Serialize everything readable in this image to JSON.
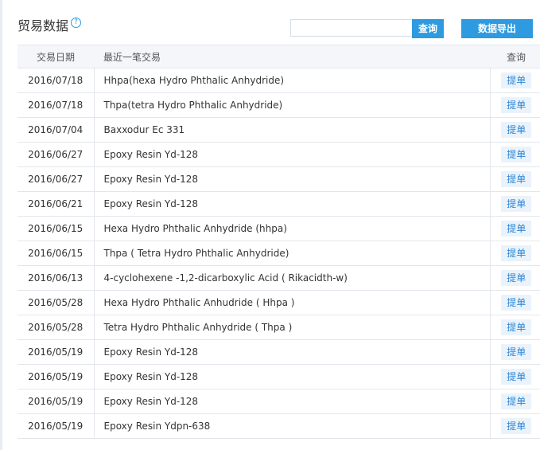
{
  "header": {
    "title": "贸易数据",
    "help_glyph": "?",
    "search_placeholder": "",
    "search_button": "查询",
    "export_button": "数据导出"
  },
  "table": {
    "columns": [
      "交易日期",
      "最近一笔交易",
      "查询"
    ],
    "rows": [
      {
        "date": "2016/07/18",
        "trade": "Hhpa(hexa Hydro Phthalic Anhydride)",
        "action": "提单"
      },
      {
        "date": "2016/07/18",
        "trade": "Thpa(tetra Hydro Phthalic Anhydride)",
        "action": "提单"
      },
      {
        "date": "2016/07/04",
        "trade": "Baxxodur Ec 331",
        "action": "提单"
      },
      {
        "date": "2016/06/27",
        "trade": "Epoxy Resin Yd-128",
        "action": "提单"
      },
      {
        "date": "2016/06/27",
        "trade": "Epoxy Resin Yd-128",
        "action": "提单"
      },
      {
        "date": "2016/06/21",
        "trade": "Epoxy Resin Yd-128",
        "action": "提单"
      },
      {
        "date": "2016/06/15",
        "trade": "Hexa Hydro Phthalic Anhydride (hhpa)",
        "action": "提单"
      },
      {
        "date": "2016/06/15",
        "trade": "Thpa ( Tetra Hydro Phthalic Anhydride)",
        "action": "提单"
      },
      {
        "date": "2016/06/13",
        "trade": "4-cyclohexene -1,2-dicarboxylic Acid ( Rikacidth-w)",
        "action": "提单"
      },
      {
        "date": "2016/05/28",
        "trade": "Hexa Hydro Phthalic Anhudride ( Hhpa )",
        "action": "提单"
      },
      {
        "date": "2016/05/28",
        "trade": "Tetra Hydro Phthalic Anhydride ( Thpa )",
        "action": "提单"
      },
      {
        "date": "2016/05/19",
        "trade": "Epoxy Resin Yd-128",
        "action": "提单"
      },
      {
        "date": "2016/05/19",
        "trade": "Epoxy Resin Yd-128",
        "action": "提单"
      },
      {
        "date": "2016/05/19",
        "trade": "Epoxy Resin Yd-128",
        "action": "提单"
      },
      {
        "date": "2016/05/19",
        "trade": "Epoxy Resin Ydpn-638",
        "action": "提单"
      }
    ]
  },
  "colors": {
    "accent": "#2e9ae0",
    "header_bg": "#f4f6f9",
    "border": "#e3e7ec",
    "bill_button_bg": "#eaf3fb"
  }
}
